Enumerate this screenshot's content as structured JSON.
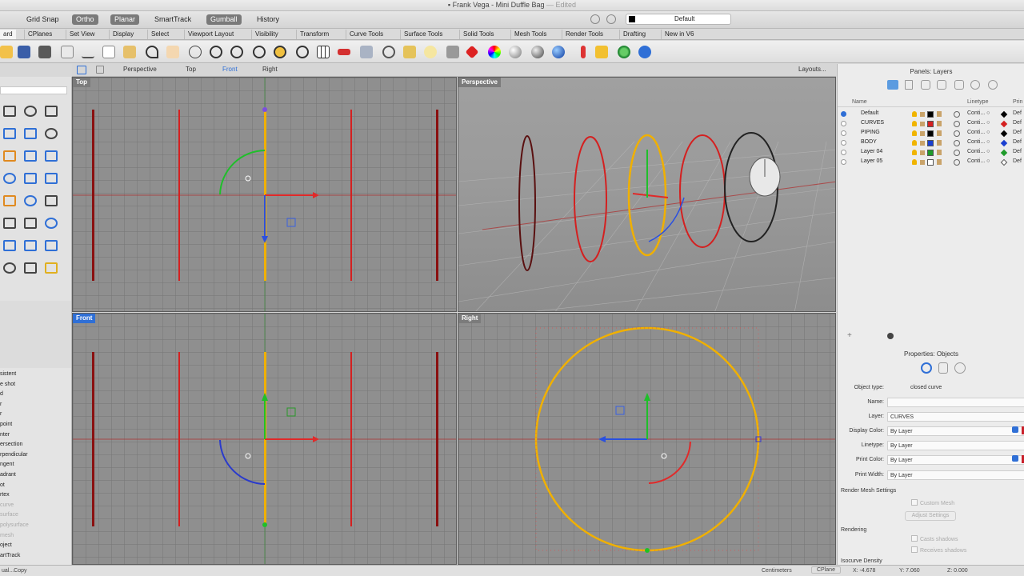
{
  "window": {
    "title": "Frank Vega - Mini Duffle Bag",
    "edited": "— Edited"
  },
  "modebar": {
    "items": [
      {
        "label": "Grid Snap",
        "on": false
      },
      {
        "label": "Ortho",
        "on": true
      },
      {
        "label": "Planar",
        "on": true
      },
      {
        "label": "SmartTrack",
        "on": false
      },
      {
        "label": "Gumball",
        "on": true
      },
      {
        "label": "History",
        "on": false
      }
    ],
    "current_layer": "Default"
  },
  "tabs": [
    "ard",
    "CPlanes",
    "Set View",
    "Display",
    "Select",
    "Viewport Layout",
    "Visibility",
    "Transform",
    "Curve Tools",
    "Surface Tools",
    "Solid Tools",
    "Mesh Tools",
    "Render Tools",
    "Drafting",
    "New in V6"
  ],
  "viewport_tabs": {
    "items": [
      "Perspective",
      "Top",
      "Front",
      "Right"
    ],
    "current": "Front",
    "layouts": "Layouts..."
  },
  "viewports": {
    "top": "Top",
    "perspective": "Perspective",
    "front": "Front",
    "right": "Right"
  },
  "osnap_items": [
    {
      "label": "sistent",
      "dim": false
    },
    {
      "label": "e shot",
      "dim": false
    },
    {
      "label": "d",
      "dim": false
    },
    {
      "label": "r",
      "dim": false
    },
    {
      "label": "r",
      "dim": false
    },
    {
      "label": "point",
      "dim": false
    },
    {
      "label": "nter",
      "dim": false
    },
    {
      "label": "ersection",
      "dim": false
    },
    {
      "label": "rpendicular",
      "dim": false
    },
    {
      "label": "ngent",
      "dim": false
    },
    {
      "label": "adrant",
      "dim": false
    },
    {
      "label": "ot",
      "dim": false
    },
    {
      "label": "rtex",
      "dim": false
    },
    {
      "label": "curve",
      "dim": true
    },
    {
      "label": "surface",
      "dim": true
    },
    {
      "label": "polysurface",
      "dim": true
    },
    {
      "label": "mesh",
      "dim": true
    },
    {
      "label": "oject",
      "dim": false
    },
    {
      "label": "artTrack",
      "dim": false
    }
  ],
  "layers_panel": {
    "title": "Panels: Layers",
    "col_name": "Name",
    "col_linetype": "Linetype",
    "col_print": "Prin",
    "rows": [
      {
        "name": "Default",
        "color": "#000000",
        "linetype": "Conti... ○",
        "print": "Def",
        "current": true
      },
      {
        "name": "CURVES",
        "color": "#d42020",
        "linetype": "Conti... ○",
        "print": "Def",
        "current": false
      },
      {
        "name": "PIPING",
        "color": "#000000",
        "linetype": "Conti... ○",
        "print": "Def",
        "current": false
      },
      {
        "name": "BODY",
        "color": "#1a3fd0",
        "linetype": "Conti... ○",
        "print": "Def",
        "current": false
      },
      {
        "name": "Layer 04",
        "color": "#1e9a2a",
        "linetype": "Conti... ○",
        "print": "Def",
        "current": false
      },
      {
        "name": "Layer 05",
        "color": "#ffffff",
        "linetype": "Conti... ○",
        "print": "Def",
        "current": false
      }
    ]
  },
  "properties_panel": {
    "title": "Properties: Objects",
    "object_type_label": "Object type:",
    "object_type": "closed curve",
    "name_label": "Name:",
    "name_value": "",
    "layer_label": "Layer:",
    "layer_value": "CURVES",
    "display_color_label": "Display Color:",
    "display_color_value": "By Layer",
    "linetype_label": "Linetype:",
    "linetype_value": "By Layer",
    "print_color_label": "Print Color:",
    "print_color_value": "By Layer",
    "print_width_label": "Print Width:",
    "print_width_value": "By Layer",
    "render_mesh_label": "Render Mesh Settings",
    "custom_mesh": "Custom Mesh",
    "adjust_settings": "Adjust Settings",
    "rendering_label": "Rendering",
    "casts_shadows": "Casts shadows",
    "receives_shadows": "Receives shadows",
    "isocurve_label": "Isocurve Density"
  },
  "statusbar": {
    "command": "ual...Copy",
    "units": "Centimeters",
    "cplane": "CPlane",
    "x": "X: -4.678",
    "y": "Y: 7.060",
    "z": "Z: 0.000"
  }
}
